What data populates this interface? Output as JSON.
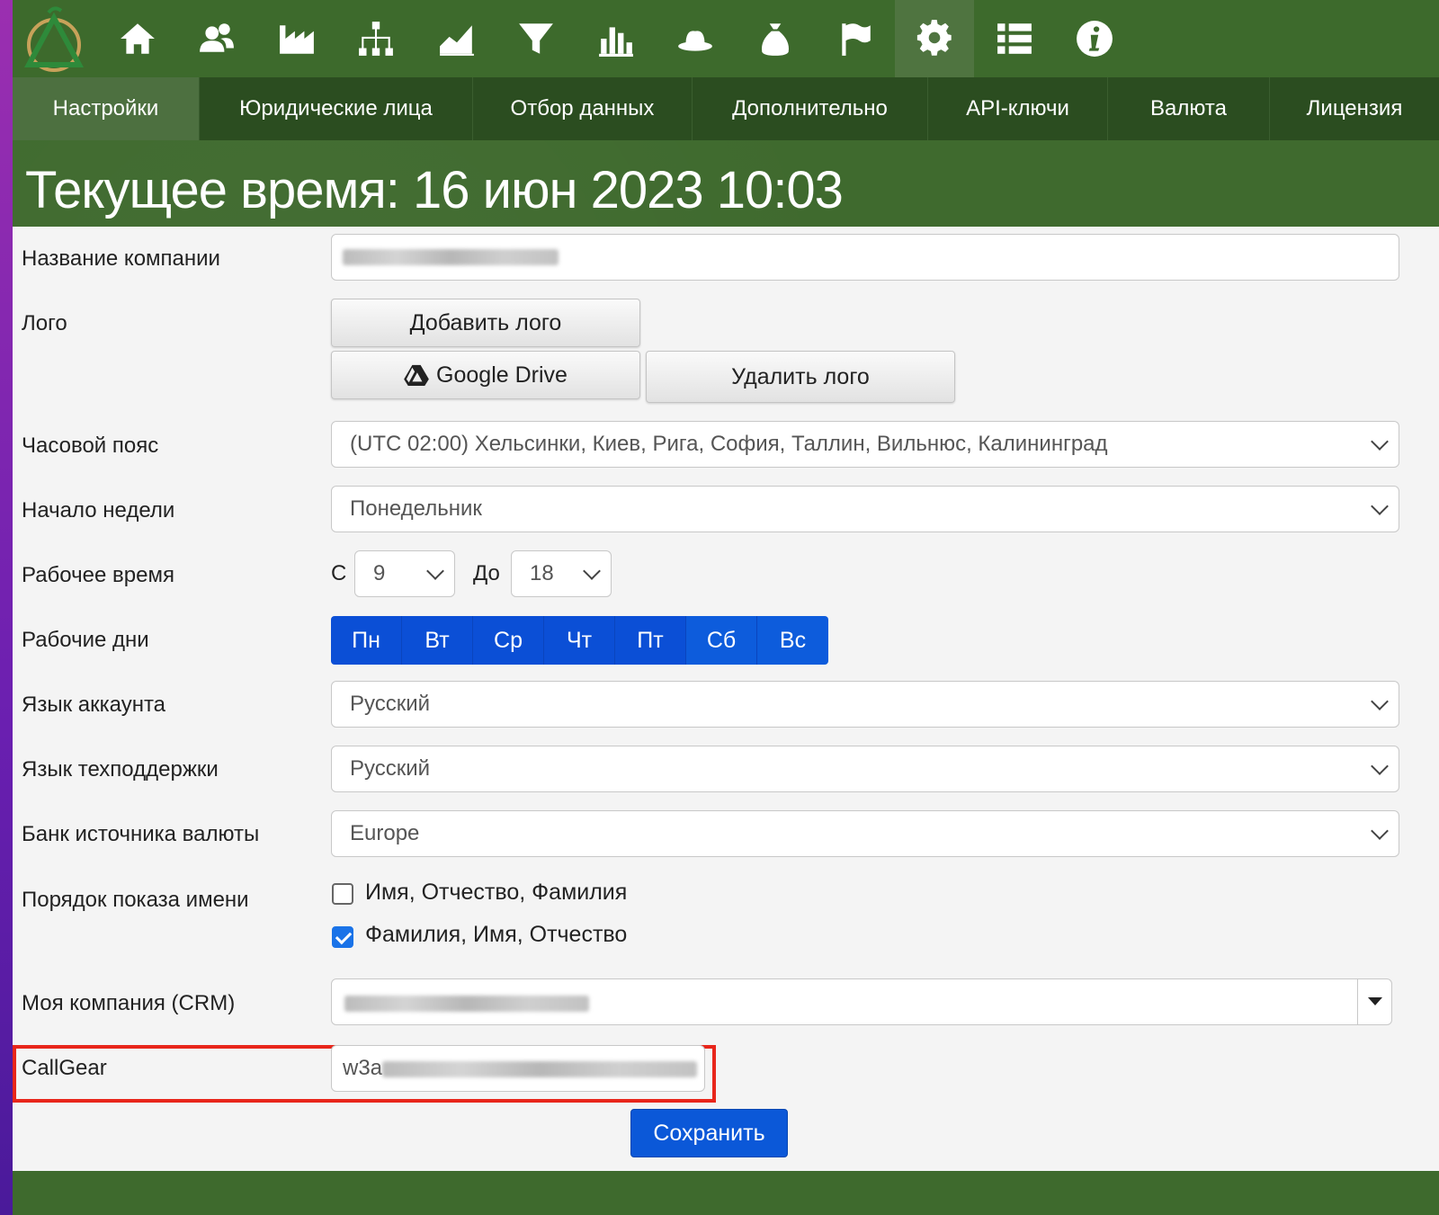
{
  "colors": {
    "nav_bg": "#3d6a2c",
    "tab_bg": "#2b4d20",
    "accent_blue": "#0b4fd6",
    "highlight": "#e8261b"
  },
  "nav_icons": [
    "home-icon",
    "contacts-icon",
    "factory-icon",
    "org-chart-icon",
    "area-chart-icon",
    "filter-icon",
    "bar-chart-icon",
    "hat-icon",
    "money-bag-icon",
    "flag-icon",
    "gear-icon",
    "list-icon",
    "info-icon"
  ],
  "tabs": [
    {
      "label": "Настройки"
    },
    {
      "label": "Юридические лица"
    },
    {
      "label": "Отбор данных"
    },
    {
      "label": "Дополнительно"
    },
    {
      "label": "API-ключи"
    },
    {
      "label": "Валюта"
    },
    {
      "label": "Лицензия"
    }
  ],
  "title": "Текущее время: 16 июн 2023 10:03",
  "form": {
    "company_name_label": "Название компании",
    "logo_label": "Лого",
    "add_logo": "Добавить лого",
    "google_drive": "Google Drive",
    "delete_logo": "Удалить лого",
    "timezone_label": "Часовой пояс",
    "timezone_value": "(UTC 02:00) Хельсинки, Киев, Рига, София, Таллин, Вильнюс, Калининград",
    "week_start_label": "Начало недели",
    "week_start_value": "Понедельник",
    "work_time_label": "Рабочее время",
    "from_label": "С",
    "from_value": "9",
    "to_label": "До",
    "to_value": "18",
    "work_days_label": "Рабочие дни",
    "days": [
      "Пн",
      "Вт",
      "Ср",
      "Чт",
      "Пт",
      "Сб",
      "Вс"
    ],
    "account_lang_label": "Язык аккаунта",
    "account_lang_value": "Русский",
    "support_lang_label": "Язык техподдержки",
    "support_lang_value": "Русский",
    "bank_label": "Банк источника валюты",
    "bank_value": "Europe",
    "name_order_label": "Порядок показа имени",
    "name_order_option1": "Имя, Отчество, Фамилия",
    "name_order_option2": "Фамилия, Имя, Отчество",
    "name_order_option1_checked": false,
    "name_order_option2_checked": true,
    "my_company_label": "Моя компания (CRM)",
    "callgear_label": "CallGear",
    "callgear_prefix": "w3a",
    "save": "Сохранить"
  }
}
